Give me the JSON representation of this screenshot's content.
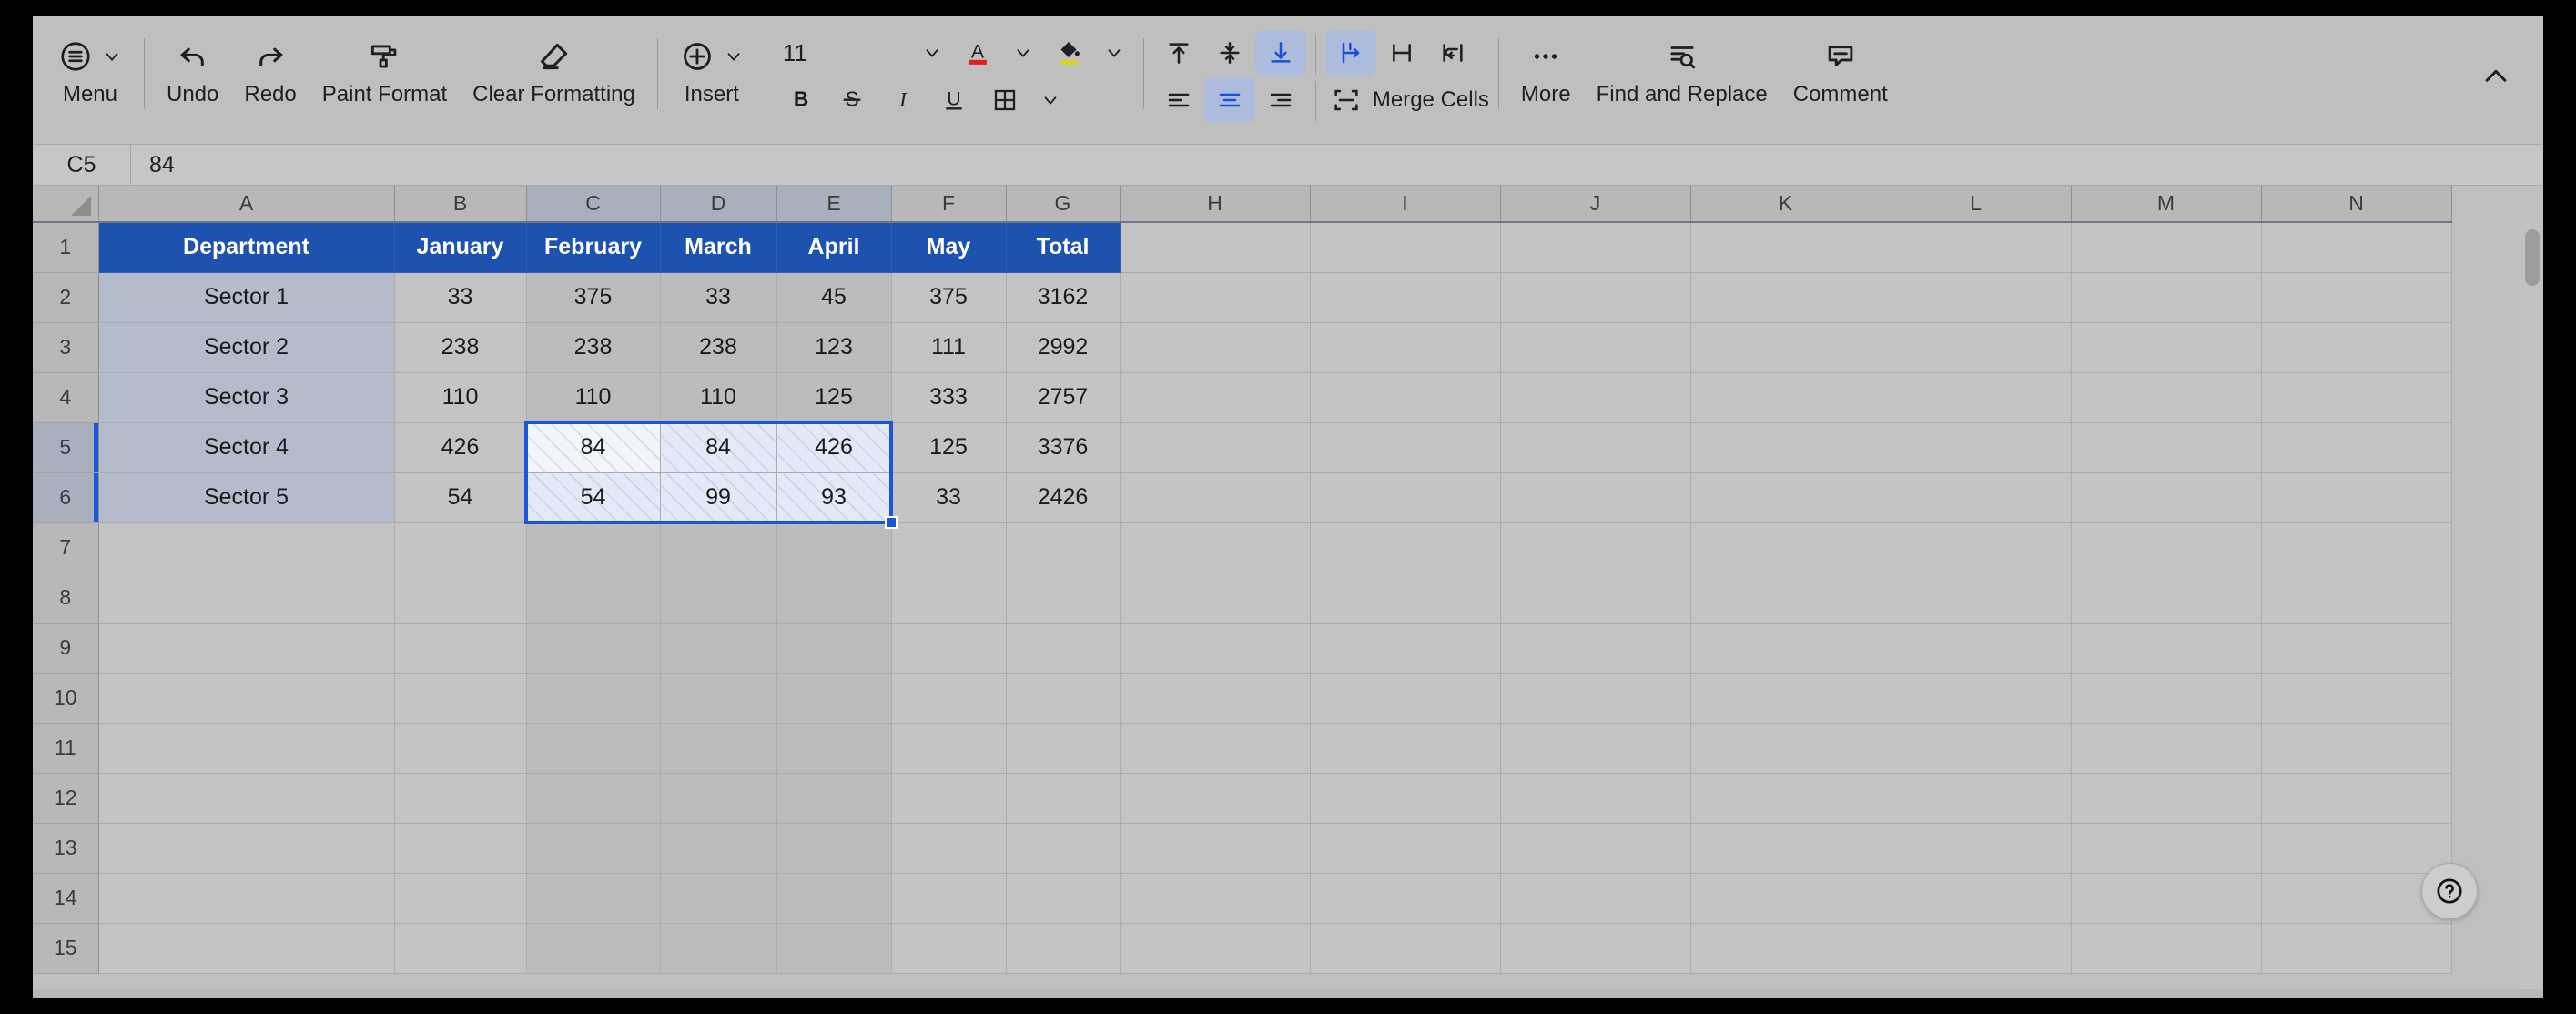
{
  "toolbar": {
    "menu_label": "Menu",
    "undo_label": "Undo",
    "redo_label": "Redo",
    "paint_format_label": "Paint Format",
    "clear_formatting_label": "Clear Formatting",
    "insert_label": "Insert",
    "font_size_value": "11",
    "merge_cells_label": "Merge Cells",
    "more_label": "More",
    "find_replace_label": "Find and Replace",
    "comment_label": "Comment",
    "text_color_accent": "#e02020",
    "fill_color_accent": "#d8d324",
    "active_accent": "#1a4fd6",
    "active_bg": "#adbbdd"
  },
  "formula_bar": {
    "name_box_value": "C5",
    "formula_value": "84"
  },
  "grid": {
    "columns": [
      "A",
      "B",
      "C",
      "D",
      "E",
      "F",
      "G",
      "H",
      "I",
      "J",
      "K",
      "L",
      "M",
      "N"
    ],
    "selected_columns": [
      "C",
      "D",
      "E"
    ],
    "rows": [
      "1",
      "2",
      "3",
      "4",
      "5",
      "6",
      "7",
      "8",
      "9",
      "10",
      "11",
      "12",
      "13",
      "14",
      "15"
    ],
    "selected_rows": [
      "5",
      "6"
    ],
    "header_row": [
      "Department",
      "January",
      "February",
      "March",
      "April",
      "May",
      "Total"
    ],
    "data_rows": [
      [
        "Sector 1",
        "33",
        "375",
        "33",
        "45",
        "375",
        "3162"
      ],
      [
        "Sector 2",
        "238",
        "238",
        "238",
        "123",
        "111",
        "2992"
      ],
      [
        "Sector 3",
        "110",
        "110",
        "110",
        "125",
        "333",
        "2757"
      ],
      [
        "Sector 4",
        "426",
        "84",
        "84",
        "426",
        "125",
        "3376"
      ],
      [
        "Sector 5",
        "54",
        "54",
        "99",
        "93",
        "33",
        "2426"
      ]
    ],
    "selection_range": "C5:E6",
    "anchor_cell": "C5",
    "header_fill_color": "#1d52b0",
    "header_text_color": "#ffffff",
    "selection_border_color": "#1a56d6"
  },
  "help": {
    "label": "help-icon"
  }
}
